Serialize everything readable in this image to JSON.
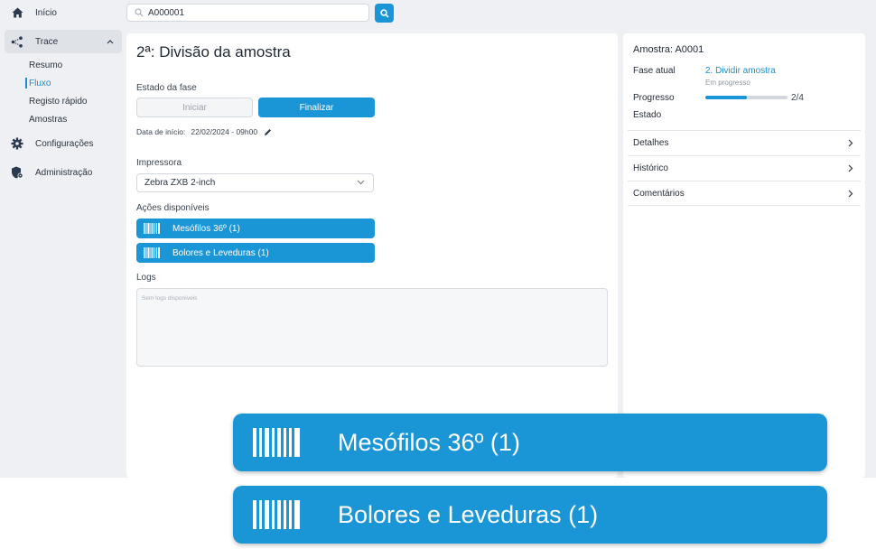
{
  "sidebar": {
    "inicio": "Início",
    "trace": "Trace",
    "sub_items": [
      "Resumo",
      "Fluxo",
      "Registo rápido",
      "Amostras"
    ],
    "configuracoes": "Configurações",
    "administracao": "Administração"
  },
  "search": {
    "value": "A000001"
  },
  "main": {
    "title": "2ª: Divisão da amostra",
    "estado_label": "Estado da fase",
    "btn_iniciar": "Iniciar",
    "btn_finalizar": "Finalizar",
    "date_label": "Data de início:",
    "date_value": "22/02/2024 - 09h00",
    "impressora_label": "Impressora",
    "impressora_value": "Zebra ZXB 2-inch",
    "acoes_label": "Ações disponíveis",
    "actions": [
      "Mesófilos 36º (1)",
      "Bolores e Leveduras (1)"
    ],
    "logs_label": "Logs",
    "logs_placeholder": "Sem logs disponíveis"
  },
  "right": {
    "title": "Amostra: A0001",
    "fase_label": "Fase atual",
    "fase_value": "2. Dividir amostra",
    "fase_status": "Em progresso",
    "progresso_label": "Progresso",
    "progress_fraction": 0.5,
    "progress_text": "2/4",
    "estado_label": "Estado",
    "rows": [
      "Detalhes",
      "Histórico",
      "Comentários"
    ]
  },
  "callouts": [
    "Mesófilos 36º (1)",
    "Bolores e Leveduras (1)"
  ],
  "colors": {
    "accent": "#1a95d6",
    "link": "#1a8fd0",
    "background": "#eef0f3"
  }
}
